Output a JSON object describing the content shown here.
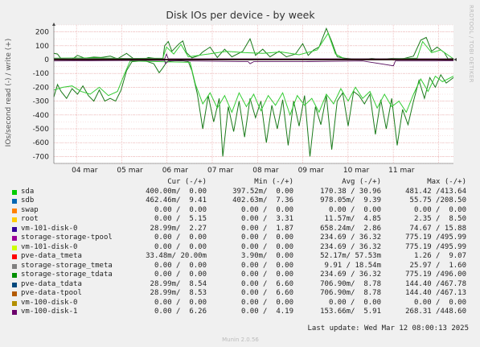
{
  "chart_data": {
    "type": "line",
    "title": "Disk IOs per device - by week",
    "ylabel": "IOs/second read (-) / write (+)",
    "ylim": [
      -750,
      250
    ],
    "yticks": [
      200,
      100,
      0,
      -100,
      -200,
      -300,
      -400,
      -500,
      -600,
      -700
    ],
    "xticks": [
      "04 mar",
      "05 mar",
      "06 mar",
      "07 mar",
      "08 mar",
      "09 mar",
      "10 mar",
      "11 mar"
    ],
    "x_start": "2025-03-03 12:00",
    "x_end": "2025-03-12 08:00",
    "series": [
      {
        "name": "vm-101-disk-0",
        "color": "#1a7a1a",
        "write": [
          [
            0,
            45
          ],
          [
            0.2,
            40
          ],
          [
            0.4,
            5
          ],
          [
            1.0,
            2
          ],
          [
            1.3,
            30
          ],
          [
            1.7,
            10
          ],
          [
            2.2,
            18
          ],
          [
            2.6,
            15
          ],
          [
            3.1,
            25
          ],
          [
            3.5,
            5
          ],
          [
            4.0,
            45
          ],
          [
            4.4,
            5
          ],
          [
            5.0,
            3
          ],
          [
            5.2,
            15
          ],
          [
            6.0,
            0
          ],
          [
            6.1,
            100
          ],
          [
            6.3,
            130
          ],
          [
            6.5,
            60
          ],
          [
            6.9,
            115
          ],
          [
            7.1,
            135
          ],
          [
            7.3,
            50
          ],
          [
            7.6,
            12
          ],
          [
            8.0,
            30
          ],
          [
            8.2,
            55
          ],
          [
            8.6,
            90
          ],
          [
            9.0,
            15
          ],
          [
            9.4,
            75
          ],
          [
            9.8,
            20
          ],
          [
            10.4,
            60
          ],
          [
            10.8,
            150
          ],
          [
            11.1,
            30
          ],
          [
            11.5,
            75
          ],
          [
            11.9,
            20
          ],
          [
            12.4,
            60
          ],
          [
            12.8,
            20
          ],
          [
            13.3,
            40
          ],
          [
            13.7,
            115
          ],
          [
            14.0,
            30
          ],
          [
            14.3,
            70
          ],
          [
            14.6,
            90
          ],
          [
            15.0,
            225
          ],
          [
            15.3,
            130
          ],
          [
            15.6,
            20
          ],
          [
            16.0,
            10
          ],
          [
            16.5,
            4
          ],
          [
            17.0,
            2
          ],
          [
            17.5,
            8
          ],
          [
            18.0,
            3
          ],
          [
            18.6,
            8
          ],
          [
            19.2,
            5
          ],
          [
            19.8,
            25
          ],
          [
            20.2,
            140
          ],
          [
            20.5,
            160
          ],
          [
            20.8,
            60
          ],
          [
            21.1,
            90
          ],
          [
            21.5,
            50
          ],
          [
            21.7,
            5
          ],
          [
            22.0,
            8
          ]
        ],
        "read": [
          [
            0,
            -270
          ],
          [
            0.2,
            -180
          ],
          [
            0.4,
            -230
          ],
          [
            0.7,
            -280
          ],
          [
            1.0,
            -210
          ],
          [
            1.3,
            -250
          ],
          [
            1.6,
            -190
          ],
          [
            1.9,
            -260
          ],
          [
            2.2,
            -300
          ],
          [
            2.5,
            -220
          ],
          [
            2.8,
            -300
          ],
          [
            3.1,
            -280
          ],
          [
            3.4,
            -300
          ],
          [
            3.7,
            -220
          ],
          [
            4.0,
            -80
          ],
          [
            4.3,
            -15
          ],
          [
            5.0,
            -8
          ],
          [
            5.5,
            -30
          ],
          [
            5.8,
            -95
          ],
          [
            6.0,
            -60
          ],
          [
            6.2,
            -20
          ],
          [
            6.5,
            -10
          ],
          [
            7.0,
            -5
          ],
          [
            7.4,
            -15
          ],
          [
            7.6,
            -80
          ],
          [
            7.9,
            -250
          ],
          [
            8.2,
            -500
          ],
          [
            8.5,
            -260
          ],
          [
            8.8,
            -450
          ],
          [
            9.1,
            -280
          ],
          [
            9.3,
            -700
          ],
          [
            9.6,
            -340
          ],
          [
            9.9,
            -520
          ],
          [
            10.2,
            -300
          ],
          [
            10.5,
            -560
          ],
          [
            10.8,
            -280
          ],
          [
            11.1,
            -420
          ],
          [
            11.4,
            -300
          ],
          [
            11.7,
            -600
          ],
          [
            12.0,
            -330
          ],
          [
            12.3,
            -500
          ],
          [
            12.6,
            -290
          ],
          [
            12.9,
            -620
          ],
          [
            13.2,
            -300
          ],
          [
            13.5,
            -480
          ],
          [
            13.8,
            -260
          ],
          [
            14.1,
            -700
          ],
          [
            14.4,
            -340
          ],
          [
            14.7,
            -470
          ],
          [
            15.0,
            -260
          ],
          [
            15.3,
            -650
          ],
          [
            15.6,
            -300
          ],
          [
            15.9,
            -240
          ],
          [
            16.2,
            -480
          ],
          [
            16.5,
            -230
          ],
          [
            16.8,
            -260
          ],
          [
            17.1,
            -320
          ],
          [
            17.4,
            -250
          ],
          [
            17.7,
            -540
          ],
          [
            18.0,
            -290
          ],
          [
            18.3,
            -500
          ],
          [
            18.6,
            -280
          ],
          [
            18.9,
            -620
          ],
          [
            19.2,
            -360
          ],
          [
            19.5,
            -470
          ],
          [
            19.8,
            -300
          ],
          [
            20.1,
            -150
          ],
          [
            20.4,
            -280
          ],
          [
            20.7,
            -130
          ],
          [
            21.0,
            -200
          ],
          [
            21.3,
            -110
          ],
          [
            21.6,
            -170
          ],
          [
            22.0,
            -130
          ]
        ]
      },
      {
        "name": "vm-101-disk-0 (light)",
        "color": "#33cc33",
        "write": [
          [
            0,
            10
          ],
          [
            2,
            12
          ],
          [
            4,
            8
          ],
          [
            6,
            10
          ],
          [
            6.2,
            90
          ],
          [
            6.6,
            40
          ],
          [
            7.0,
            110
          ],
          [
            7.4,
            20
          ],
          [
            8.5,
            40
          ],
          [
            9.5,
            60
          ],
          [
            10.5,
            50
          ],
          [
            11.5,
            45
          ],
          [
            12.5,
            55
          ],
          [
            13.5,
            35
          ],
          [
            14.5,
            70
          ],
          [
            15.1,
            190
          ],
          [
            15.5,
            40
          ],
          [
            16,
            5
          ],
          [
            18,
            5
          ],
          [
            20,
            10
          ],
          [
            20.3,
            130
          ],
          [
            20.8,
            50
          ],
          [
            21.3,
            70
          ],
          [
            22,
            5
          ]
        ],
        "read": [
          [
            0,
            -220
          ],
          [
            0.5,
            -200
          ],
          [
            1,
            -190
          ],
          [
            1.5,
            -230
          ],
          [
            2,
            -250
          ],
          [
            2.5,
            -200
          ],
          [
            3,
            -260
          ],
          [
            3.5,
            -230
          ],
          [
            3.9,
            -100
          ],
          [
            4.2,
            -10
          ],
          [
            7.5,
            -20
          ],
          [
            7.8,
            -180
          ],
          [
            8.2,
            -320
          ],
          [
            8.6,
            -240
          ],
          [
            9.0,
            -350
          ],
          [
            9.4,
            -260
          ],
          [
            9.8,
            -380
          ],
          [
            10.2,
            -240
          ],
          [
            10.6,
            -340
          ],
          [
            11.0,
            -250
          ],
          [
            11.4,
            -370
          ],
          [
            11.8,
            -260
          ],
          [
            12.2,
            -330
          ],
          [
            12.6,
            -240
          ],
          [
            13.0,
            -400
          ],
          [
            13.4,
            -260
          ],
          [
            13.8,
            -330
          ],
          [
            14.2,
            -280
          ],
          [
            14.6,
            -380
          ],
          [
            15.0,
            -250
          ],
          [
            15.4,
            -320
          ],
          [
            15.8,
            -210
          ],
          [
            16.2,
            -300
          ],
          [
            16.6,
            -200
          ],
          [
            17.0,
            -280
          ],
          [
            17.4,
            -230
          ],
          [
            17.8,
            -350
          ],
          [
            18.2,
            -250
          ],
          [
            18.6,
            -340
          ],
          [
            19.0,
            -300
          ],
          [
            19.4,
            -380
          ],
          [
            19.8,
            -250
          ],
          [
            20.2,
            -140
          ],
          [
            20.6,
            -230
          ],
          [
            21.0,
            -120
          ],
          [
            21.4,
            -160
          ],
          [
            22,
            -120
          ]
        ]
      },
      {
        "name": "vm-100-disk-1",
        "color": "#5a1060",
        "write": [
          [
            0,
            5
          ],
          [
            6.1,
            5
          ],
          [
            6.2,
            40
          ],
          [
            6.3,
            5
          ],
          [
            22,
            5
          ]
        ],
        "read": [
          [
            0,
            -10
          ],
          [
            2,
            -8
          ],
          [
            6.1,
            -5
          ],
          [
            6.15,
            -30
          ],
          [
            6.3,
            -8
          ],
          [
            10.7,
            -15
          ],
          [
            10.8,
            -30
          ],
          [
            11,
            -15
          ],
          [
            13.5,
            -15
          ],
          [
            17,
            -10
          ],
          [
            18.7,
            -45
          ],
          [
            18.8,
            -10
          ],
          [
            21,
            -10
          ],
          [
            22,
            -8
          ]
        ]
      },
      {
        "name": "sda",
        "color": "#cc0000",
        "write": [
          [
            0,
            2
          ],
          [
            22,
            2
          ]
        ],
        "read": [
          [
            0,
            -2
          ],
          [
            22,
            -2
          ]
        ]
      }
    ]
  },
  "side_text": "RRDTOOL / TOBI OETIKER",
  "footer": "Munin 2.0.56",
  "legend": {
    "header": {
      "cur": "Cur (-/+)",
      "min": "Min (-/+)",
      "avg": "Avg (-/+)",
      "max": "Max (-/+)"
    },
    "rows": [
      {
        "name": "sda",
        "color": "#00cc00",
        "cur": "400.00m/  0.00",
        "min": "397.52m/  0.00",
        "avg": "170.38 / 30.96",
        "max": "481.42 /413.64"
      },
      {
        "name": "sdb",
        "color": "#0066b3",
        "cur": "462.46m/  9.41",
        "min": "402.63m/  7.36",
        "avg": "978.05m/  9.39",
        "max": "55.75 /208.50"
      },
      {
        "name": "swap",
        "color": "#ff8000",
        "cur": "0.00 /  0.00",
        "min": "0.00 /  0.00",
        "avg": "0.00 /  0.00",
        "max": "0.00 /  0.00"
      },
      {
        "name": "root",
        "color": "#ffcc00",
        "cur": "0.00 /  5.15",
        "min": "0.00 /  3.31",
        "avg": "11.57m/  4.85",
        "max": "2.35 /  8.50"
      },
      {
        "name": "vm-101-disk-0",
        "color": "#330099",
        "cur": "28.99m/  2.27",
        "min": "0.00 /  1.87",
        "avg": "658.24m/  2.86",
        "max": "74.67 / 15.88"
      },
      {
        "name": "storage-storage-tpool",
        "color": "#990099",
        "cur": "0.00 /  0.00",
        "min": "0.00 /  0.00",
        "avg": "234.69 / 36.32",
        "max": "775.19 /495.99"
      },
      {
        "name": "vm-101-disk-0",
        "color": "#ccff00",
        "cur": "0.00 /  0.00",
        "min": "0.00 /  0.00",
        "avg": "234.69 / 36.32",
        "max": "775.19 /495.99"
      },
      {
        "name": "pve-data_tmeta",
        "color": "#ff0000",
        "cur": "33.48m/ 20.00m",
        "min": "3.90m/  0.00",
        "avg": "52.17m/ 57.53m",
        "max": "1.26 /  9.07"
      },
      {
        "name": "storage-storage_tmeta",
        "color": "#808080",
        "cur": "0.00 /  0.00",
        "min": "0.00 /  0.00",
        "avg": "9.91 / 18.54m",
        "max": "25.97 /  1.60"
      },
      {
        "name": "storage-storage_tdata",
        "color": "#008f00",
        "cur": "0.00 /  0.00",
        "min": "0.00 /  0.00",
        "avg": "234.69 / 36.32",
        "max": "775.19 /496.00"
      },
      {
        "name": "pve-data_tdata",
        "color": "#00487d",
        "cur": "28.99m/  8.54",
        "min": "0.00 /  6.60",
        "avg": "706.90m/  8.78",
        "max": "144.40 /467.78"
      },
      {
        "name": "pve-data-tpool",
        "color": "#b35a00",
        "cur": "28.99m/  8.53",
        "min": "0.00 /  6.60",
        "avg": "706.90m/  8.78",
        "max": "144.40 /467.13"
      },
      {
        "name": "vm-100-disk-0",
        "color": "#b38f00",
        "cur": "0.00 /  0.00",
        "min": "0.00 /  0.00",
        "avg": "0.00 /  0.00",
        "max": "0.00 /  0.00"
      },
      {
        "name": "vm-100-disk-1",
        "color": "#6b006b",
        "cur": "0.00 /  6.26",
        "min": "0.00 /  4.19",
        "avg": "153.66m/  5.91",
        "max": "268.31 /448.60"
      }
    ]
  },
  "last_update": "Last update: Wed Mar 12 08:00:13 2025"
}
